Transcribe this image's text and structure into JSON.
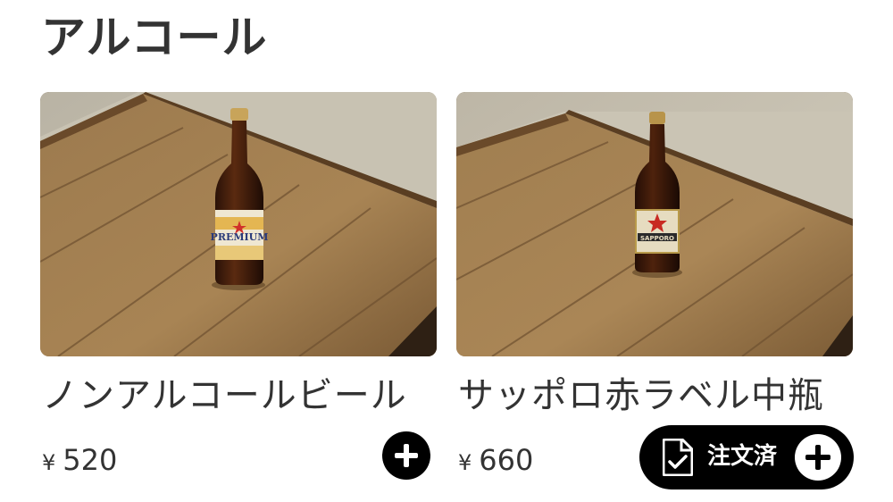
{
  "section": {
    "title": "アルコール"
  },
  "items": [
    {
      "name": "ノンアルコールビール",
      "currency": "¥",
      "price": "520",
      "image": "beer-bottle-premium-photo",
      "ordered": false
    },
    {
      "name": "サッポロ赤ラベル中瓶",
      "currency": "¥",
      "price": "660",
      "image": "beer-bottle-sapporo-red-label-photo",
      "ordered": true,
      "ordered_label": "注文済"
    }
  ],
  "colors": {
    "text": "#333333",
    "button_bg": "#000000",
    "button_fg": "#ffffff"
  },
  "icons": {
    "add": "plus-icon",
    "ordered": "document-check-icon"
  }
}
